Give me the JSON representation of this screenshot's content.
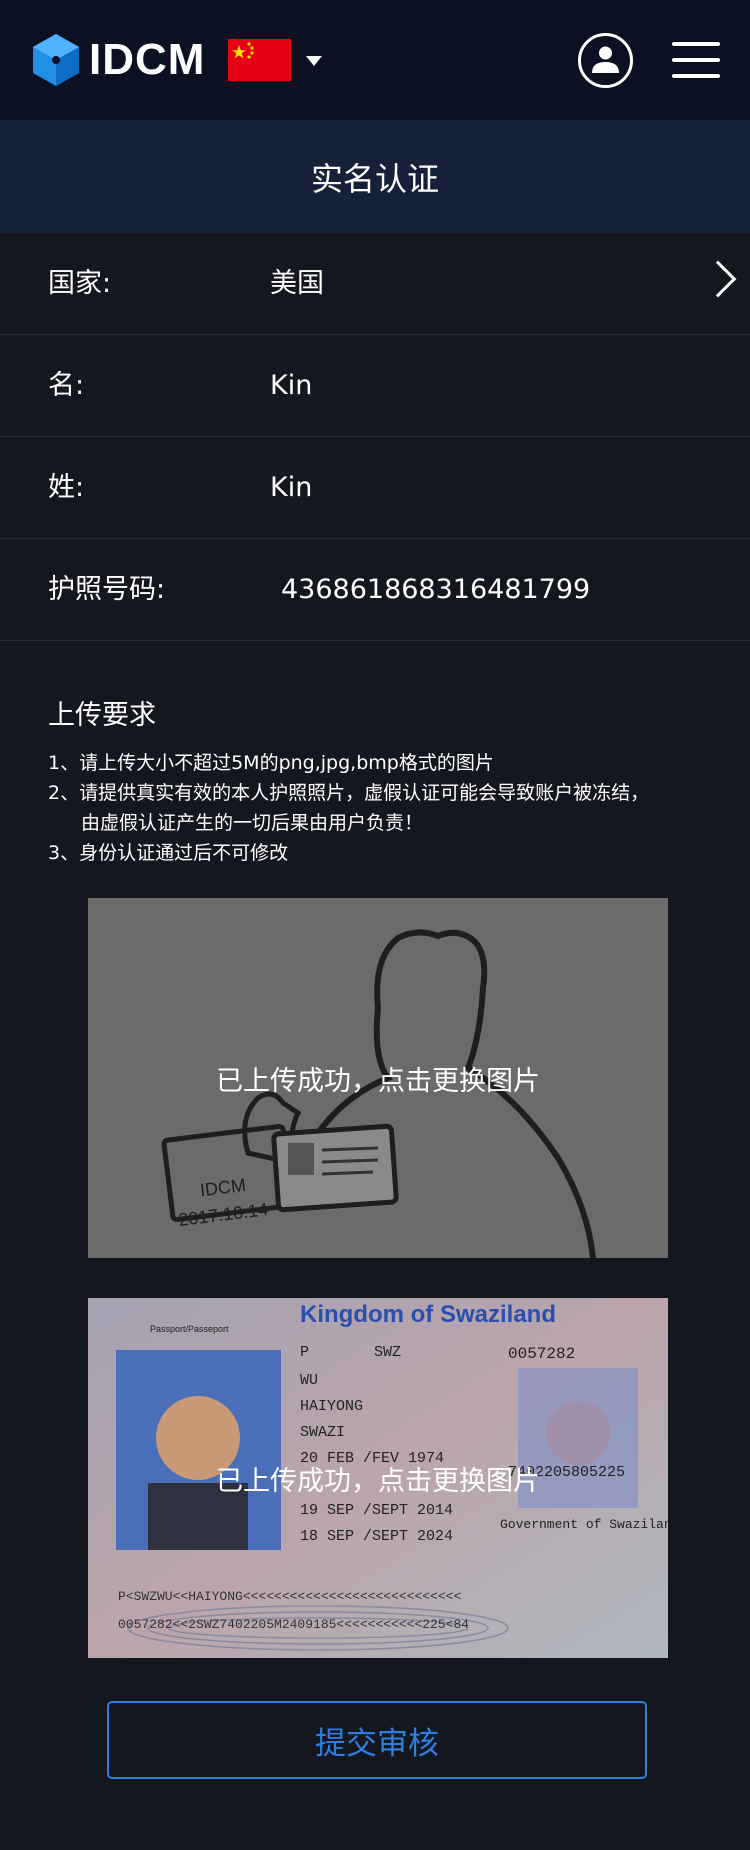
{
  "header": {
    "logo_text": "IDCM",
    "flag_icon": "china-flag-icon",
    "user_icon": "user-circle-icon",
    "menu_icon": "hamburger-menu-icon"
  },
  "page": {
    "title": "实名认证"
  },
  "form": {
    "country_label": "国家:",
    "country_value": "美国",
    "first_name_label": "名:",
    "first_name_value": "Kin",
    "last_name_label": "姓:",
    "last_name_value": "Kin",
    "passport_label": "护照号码:",
    "passport_value": "436861868316481799"
  },
  "requirements": {
    "title": "上传要求",
    "line1": "1、请上传大小不超过5M的png,jpg,bmp格式的图片",
    "line2a": "2、请提供真实有效的本人护照照片，虚假认证可能会导致账户被冻结，",
    "line2b": "由虚假认证产生的一切后果由用户负责！",
    "line3": "3、身份认证通过后不可修改"
  },
  "uploads": {
    "handheld": {
      "status_text": "已上传成功，点击更换图片",
      "card_text": "IDCM",
      "card_date": "2017.10.14"
    },
    "passport": {
      "status_text": "已上传成功，点击更换图片",
      "header": "Kingdom of Swaziland",
      "doc_header": "Passport/Passeport",
      "type": "P",
      "country_code": "SWZ",
      "passport_no": "0057282",
      "surname": "WU",
      "given_names": "HAIYONG",
      "nationality": "SWAZI",
      "dob": "20 FEB /FEV 1974",
      "issue_date": "19 SEP /SEPT 2014",
      "expiry_date": "18 SEP /SEPT 2024",
      "personal_no": "7402205805225",
      "authority": "Government of Swaziland",
      "mrz1": "P<SWZWU<<HAIYONG<<<<<<<<<<<<<<<<<<<<<<<<<<<<",
      "mrz2": "0057282<<2SWZ7402205M2409185<<<<<<<<<<<225<84"
    }
  },
  "submit_label": "提交审核",
  "colors": {
    "header_bg": "#0b1022",
    "titlebar_bg": "#162038",
    "page_bg": "#141620",
    "accent": "#2f7fe0"
  }
}
